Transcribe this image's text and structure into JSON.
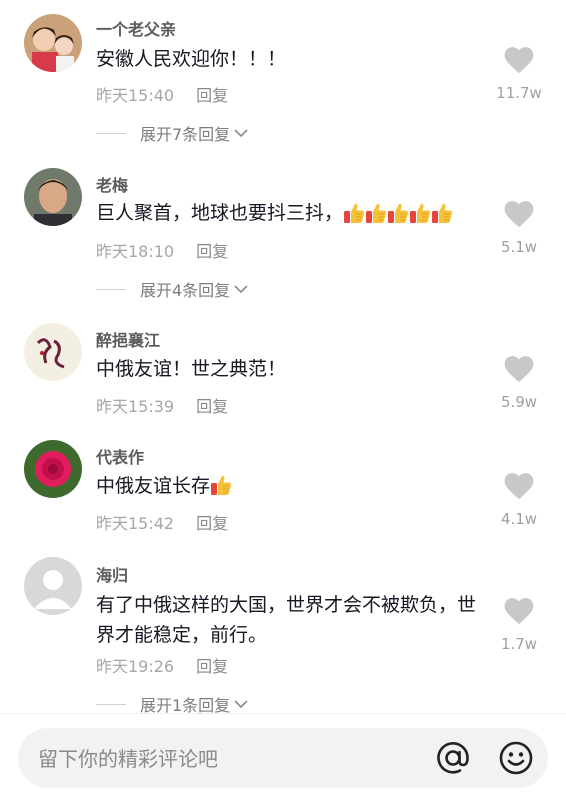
{
  "comments": [
    {
      "username": "一个老父亲",
      "text": "安徽人民欢迎你！！！",
      "time": "昨天15:40",
      "reply": "回复",
      "likes": "11.7w",
      "expand": "展开7条回复"
    },
    {
      "username": "老梅",
      "text": "巨人聚首，地球也要抖三抖，",
      "time": "昨天18:10",
      "reply": "回复",
      "likes": "5.1w",
      "expand": "展开4条回复"
    },
    {
      "username": "醉挹襄江",
      "text": "中俄友谊！世之典范！",
      "time": "昨天15:39",
      "reply": "回复",
      "likes": "5.9w"
    },
    {
      "username": "代表作",
      "text": "中俄友谊长存",
      "time": "昨天15:42",
      "reply": "回复",
      "likes": "4.1w"
    },
    {
      "username": "海归",
      "text": "有了中俄这样的大国，世界才会不被欺负，世界才能稳定，前行。",
      "time": "昨天19:26",
      "reply": "回复",
      "likes": "1.7w",
      "expand": "展开1条回复"
    }
  ],
  "input": {
    "placeholder": "留下你的精彩评论吧"
  },
  "icons": {
    "like": "heart-icon",
    "mention": "at-icon",
    "emoji": "smiley-icon",
    "thumbs": "thumbs-up-emoji"
  },
  "colors": {
    "heart": "#c8c8c8",
    "meta": "#a6a6a6",
    "username": "#5c5c5c"
  }
}
